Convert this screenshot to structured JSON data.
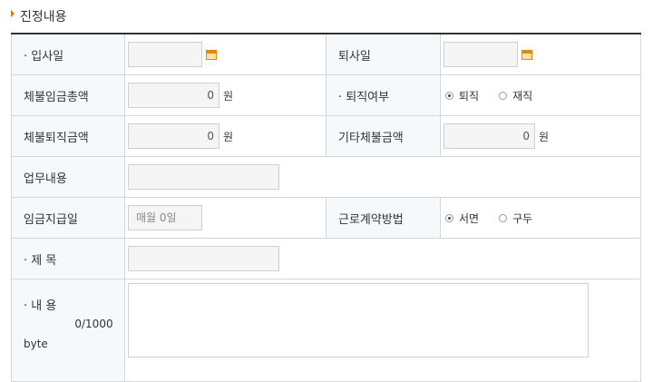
{
  "section": {
    "title": "진정내용"
  },
  "fields": {
    "join_date": {
      "label": "입사일"
    },
    "leave_date": {
      "label": "퇴사일"
    },
    "unpaid_wages": {
      "label": "체불임금총액",
      "value": "0",
      "unit": "원"
    },
    "retire_status": {
      "label": "퇴직여부",
      "options": [
        "퇴직",
        "재직"
      ],
      "selected": "퇴직"
    },
    "unpaid_severance": {
      "label": "체불퇴직금액",
      "value": "0",
      "unit": "원"
    },
    "other_unpaid": {
      "label": "기타체불금액",
      "value": "0",
      "unit": "원"
    },
    "work_content": {
      "label": "업무내용"
    },
    "pay_day": {
      "label": "임금지급일",
      "placeholder": "매월 0일"
    },
    "contract_method": {
      "label": "근로계약방법",
      "options": [
        "서면",
        "구두"
      ],
      "selected": "서면"
    },
    "subject": {
      "label": "제 목"
    },
    "content": {
      "label": "내 용",
      "count": "0",
      "limit": "/1000",
      "unit": "byte"
    }
  },
  "colors": {
    "accent": "#e07020",
    "label_bg": "#f6f9fb"
  },
  "icons": [
    "calendar-icon",
    "radio-icon"
  ]
}
